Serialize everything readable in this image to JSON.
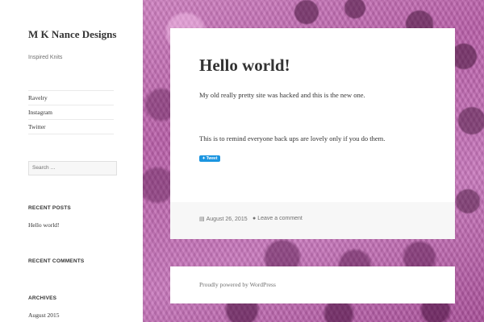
{
  "site": {
    "title": "M K Nance Designs",
    "description": "Inspired Knits"
  },
  "menu": {
    "items": [
      {
        "label": "Ravelry"
      },
      {
        "label": "Instagram"
      },
      {
        "label": "Twitter"
      }
    ]
  },
  "search": {
    "placeholder": "Search …"
  },
  "widgets": {
    "recent_posts": {
      "title": "RECENT POSTS",
      "items": [
        "Hello world!"
      ]
    },
    "recent_comments": {
      "title": "RECENT COMMENTS"
    },
    "archives": {
      "title": "ARCHIVES",
      "items": [
        "August 2015"
      ]
    }
  },
  "post": {
    "title": "Hello world!",
    "paragraphs": [
      "My old really pretty site was hacked and this is the new one.",
      "This is to remind everyone back ups are lovely only if you do them."
    ],
    "tweet_label": "Tweet",
    "date": "August 26, 2015",
    "comment_link": "Leave a comment",
    "icons": {
      "date": "calendar-icon",
      "comment": "speech-bubble-icon"
    }
  },
  "footer": {
    "text": "Proudly powered by WordPress"
  },
  "colors": {
    "tweet_button": "#1b95e0",
    "background_accent": "#c36fb6"
  }
}
